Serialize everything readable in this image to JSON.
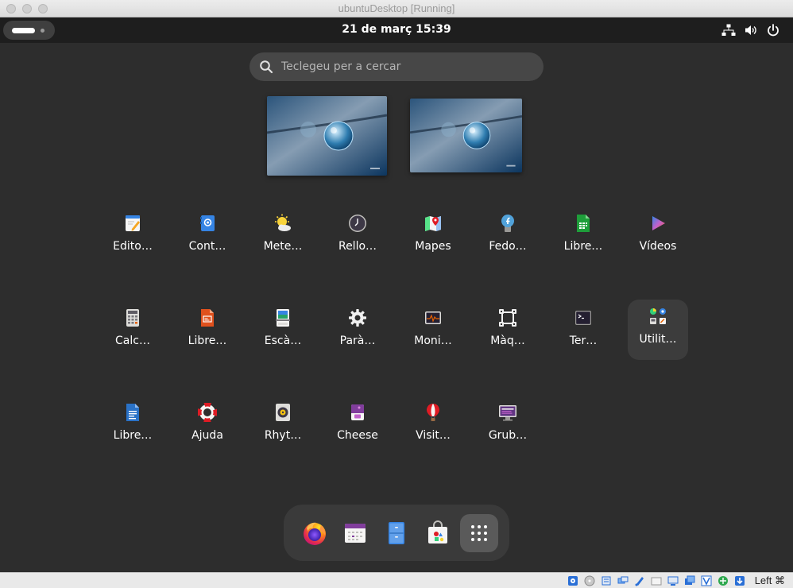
{
  "window": {
    "title": "ubuntuDesktop [Running]"
  },
  "topbar": {
    "clock": "21 de març  15:39"
  },
  "search": {
    "placeholder": "Teclegeu per a cercar"
  },
  "apps": [
    {
      "label": "Edito…",
      "icon": "text-editor-icon"
    },
    {
      "label": "Cont…",
      "icon": "contacts-icon"
    },
    {
      "label": "Mete…",
      "icon": "weather-icon"
    },
    {
      "label": "Rello…",
      "icon": "clock-icon"
    },
    {
      "label": "Mapes",
      "icon": "maps-icon"
    },
    {
      "label": "Fedo…",
      "icon": "fedora-media-writer-icon"
    },
    {
      "label": "Libre…",
      "icon": "libreoffice-calc-icon"
    },
    {
      "label": "Vídeos",
      "icon": "videos-icon"
    },
    {
      "label": "Calc…",
      "icon": "calculator-icon"
    },
    {
      "label": "Libre…",
      "icon": "libreoffice-impress-icon"
    },
    {
      "label": "Escà…",
      "icon": "scanner-icon"
    },
    {
      "label": "Parà…",
      "icon": "settings-icon"
    },
    {
      "label": "Moni…",
      "icon": "system-monitor-icon"
    },
    {
      "label": "Màq…",
      "icon": "boxes-icon"
    },
    {
      "label": "Ter…",
      "icon": "terminal-icon"
    },
    {
      "label": "Utilit…",
      "icon": "utilities-folder-icon"
    },
    {
      "label": "Libre…",
      "icon": "libreoffice-writer-icon"
    },
    {
      "label": "Ajuda",
      "icon": "help-icon"
    },
    {
      "label": "Rhyt…",
      "icon": "rhythmbox-icon"
    },
    {
      "label": "Cheese",
      "icon": "cheese-icon"
    },
    {
      "label": "Visit…",
      "icon": "tour-icon"
    },
    {
      "label": "Grub…",
      "icon": "grub-customizer-icon"
    }
  ],
  "dash": [
    {
      "name": "firefox-icon"
    },
    {
      "name": "calendar-icon"
    },
    {
      "name": "files-icon"
    },
    {
      "name": "software-icon"
    },
    {
      "name": "show-apps-icon"
    }
  ],
  "statusbar": {
    "host_key": "Left ⌘"
  }
}
